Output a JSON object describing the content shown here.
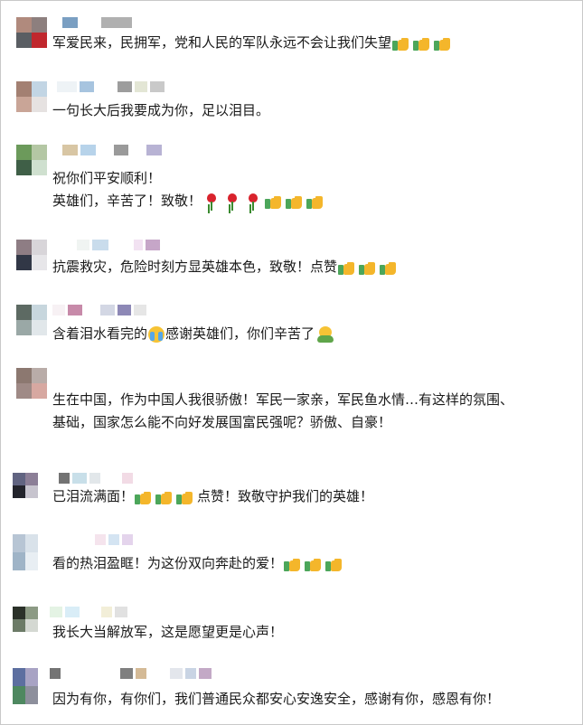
{
  "comments": [
    {
      "avatar": [
        "#b08a7d",
        "#8d7f7e",
        "#5a5e63",
        "#c0272d"
      ],
      "name": [
        "#7a9fc2",
        "#dcdcdc",
        "#b0b0b0"
      ],
      "lines": [
        {
          "text": "军爱民来，民拥军，党和人民的军队永远不会让我们失望",
          "emoji": [
            "thumbs-up",
            "thumbs-up",
            "thumbs-up"
          ]
        }
      ]
    },
    {
      "avatar": [
        "#a38072",
        "#c2d5e4",
        "#c9a597",
        "#e6e2e1"
      ],
      "name": [
        "#eef3f6",
        "#a7c4df",
        "#9d9d9d",
        "#e3e6d5",
        "#c9c9c9"
      ],
      "lines": [
        {
          "text": "一句长大后我要成为你，足以泪目。",
          "emoji": []
        }
      ]
    },
    {
      "avatar": [
        "#6c9a5b",
        "#b4c7a4",
        "#3f5f47",
        "#cfe0cf"
      ],
      "name": [
        "#d8c6a4",
        "#b7d3ea",
        "#9a9a9a",
        "#b8b3d4"
      ],
      "lines": [
        {
          "text": "祝你们平安顺利！",
          "emoji": []
        },
        {
          "text": "英雄们，辛苦了！致敬！",
          "emoji": [
            "rose",
            "rose",
            "rose",
            "thumbs-up",
            "thumbs-up",
            "thumbs-up"
          ]
        }
      ]
    },
    {
      "avatar": [
        "#8e7d84",
        "#d8d5d9",
        "#313746",
        "#e7e6e9"
      ],
      "name": [
        "#f0f4f2",
        "#c9dcec",
        "#f2e2f2",
        "#c6a6c8"
      ],
      "lines": [
        {
          "text": "抗震救灾，危险时刻方显英雄本色，致敬！点赞",
          "emoji": [
            "thumbs-up",
            "thumbs-up",
            "thumbs-up"
          ]
        }
      ]
    },
    {
      "avatar": [
        "#5d6a63",
        "#c7d6dd",
        "#9aa8a6",
        "#e1e7ea"
      ],
      "name": [
        "#f7f1f4",
        "#c78aa9",
        "#d3d7e4",
        "#8d88b6",
        "#e6e6e6"
      ],
      "lines": [
        {
          "text": "含着泪水看完的",
          "emoji": [
            "crying-face"
          ]
        },
        {
          "text": "感谢英雄们，你们辛苦了",
          "emoji": [
            "hug-face"
          ]
        }
      ]
    },
    {
      "avatar": [
        "#8c7870",
        "#b9aca8",
        "#9f8a86",
        "#d7a8a1"
      ],
      "name": [],
      "lines": [
        {
          "text": "生在中国，作为中国人我很骄傲！军民一家亲，军民鱼水情…有这样的氛围、",
          "emoji": []
        },
        {
          "text": "基础，国家怎么能不向好发展国富民强呢？骄傲、自豪！",
          "emoji": []
        }
      ]
    },
    {
      "avatar": [
        "#616481",
        "#8c7f97",
        "#23242c",
        "#c7c4ce"
      ],
      "name": [
        "#737373",
        "#c8dfe9",
        "#e2e7ea",
        "#f2dbe5"
      ],
      "lines": [
        {
          "text": "已泪流满面！",
          "emoji": [
            "thumbs-up",
            "thumbs-up",
            "thumbs-up"
          ],
          "after": "点赞！致敬守护我们的英雄！"
        }
      ]
    },
    {
      "avatar": [
        "#b7c5d4",
        "#d9e2ea",
        "#9fb4c7",
        "#e8eef3"
      ],
      "name": [
        "#f5e4ed",
        "#d4e4f2",
        "#e4d4ec"
      ],
      "lines": [
        {
          "text": "看的热泪盈眶！为这份双向奔赴的爱！",
          "emoji": [
            "thumbs-up",
            "thumbs-up",
            "thumbs-up"
          ]
        }
      ]
    },
    {
      "avatar": [
        "#2b3129",
        "#8c9a84",
        "#6c7b67",
        "#d4d8d2"
      ],
      "name": [
        "#e4f3e4",
        "#d9edf7",
        "#f2eed8",
        "#e1e1e1"
      ],
      "lines": [
        {
          "text": "我长大当解放军，这是愿望更是心声！",
          "emoji": []
        }
      ]
    },
    {
      "avatar": [
        "#5d6fa0",
        "#a8a3c4",
        "#4e8860",
        "#8d8f9c"
      ],
      "name": [
        "#747474",
        "#7f7f7f",
        "#d4ba96",
        "#e3e6ec",
        "#c9d4e4",
        "#c3a9c6"
      ],
      "lines": [
        {
          "text": "因为有你，有你们，我们普通民众都安心安逸安全，感谢有你，感恩有你！",
          "emoji": []
        }
      ]
    }
  ]
}
